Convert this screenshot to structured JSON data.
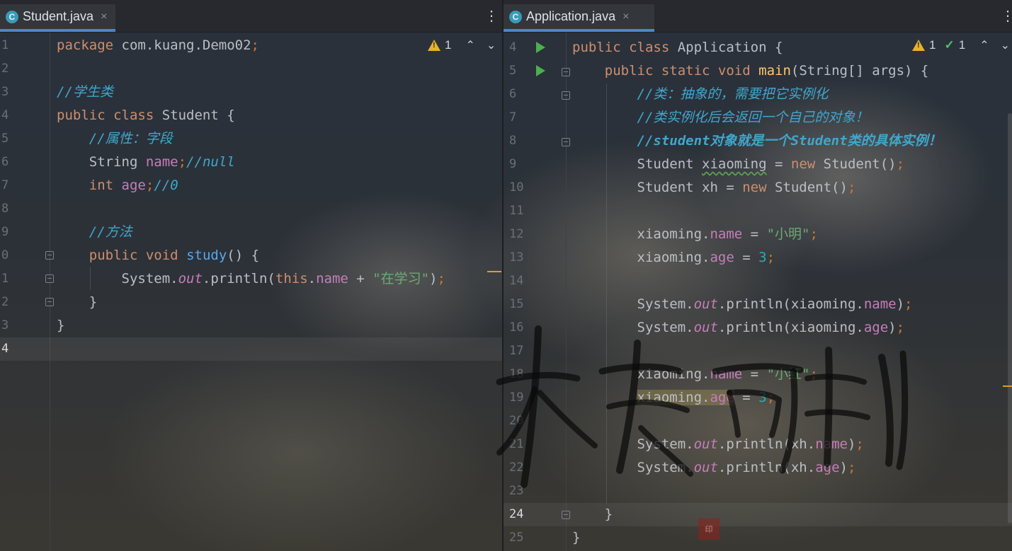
{
  "left_editor": {
    "tab": {
      "filename": "Student.java",
      "icon": "class-icon",
      "icon_letter": "C"
    },
    "inspections": {
      "warnings": "1"
    },
    "current_line": "4",
    "line_numbers": [
      "1",
      "2",
      "3",
      "4",
      "5",
      "6",
      "7",
      "8",
      "9",
      "0",
      "1",
      "2",
      "3",
      "4"
    ],
    "lines": [
      [
        [
          "kw",
          "package"
        ],
        [
          "pl",
          " com.kuang.Demo02"
        ],
        [
          "sem",
          ";"
        ]
      ],
      [],
      [
        [
          "cmt",
          "//学生类"
        ]
      ],
      [
        [
          "kw",
          "public class"
        ],
        [
          "pl",
          " Student {"
        ]
      ],
      [
        [
          "pl",
          "    "
        ],
        [
          "cmt",
          "//属性：字段"
        ]
      ],
      [
        [
          "pl",
          "    String "
        ],
        [
          "field",
          "name"
        ],
        [
          "sem",
          ";"
        ],
        [
          "cmt",
          "//null"
        ]
      ],
      [
        [
          "pl",
          "    "
        ],
        [
          "kw",
          "int"
        ],
        [
          "pl",
          " "
        ],
        [
          "field",
          "age"
        ],
        [
          "sem",
          ";"
        ],
        [
          "cmt",
          "//0"
        ]
      ],
      [],
      [
        [
          "pl",
          "    "
        ],
        [
          "cmt",
          "//方法"
        ]
      ],
      [
        [
          "pl",
          "    "
        ],
        [
          "kw",
          "public void"
        ],
        [
          "pl",
          " "
        ],
        [
          "fn",
          "study"
        ],
        [
          "pl",
          "() {"
        ]
      ],
      [
        [
          "pl",
          "        System."
        ],
        [
          "st",
          "out"
        ],
        [
          "pl",
          ".println("
        ],
        [
          "kw",
          "this"
        ],
        [
          "pl",
          "."
        ],
        [
          "field",
          "name"
        ],
        [
          "pl",
          " + "
        ],
        [
          "str",
          "\"在学习\""
        ],
        [
          "pl",
          ")"
        ],
        [
          "sem",
          ";"
        ]
      ],
      [
        [
          "pl",
          "    }"
        ]
      ],
      [
        [
          "pl",
          "}"
        ]
      ],
      []
    ]
  },
  "right_editor": {
    "tab": {
      "filename": "Application.java",
      "icon": "class-icon",
      "icon_letter": "C"
    },
    "inspections": {
      "warnings": "1",
      "typos": "1"
    },
    "current_line": "24",
    "line_numbers": [
      "4",
      "5",
      "6",
      "7",
      "8",
      "9",
      "10",
      "11",
      "12",
      "13",
      "14",
      "15",
      "16",
      "17",
      "18",
      "19",
      "20",
      "21",
      "22",
      "23",
      "24",
      "25"
    ],
    "lines": [
      [
        [
          "kw",
          "public class"
        ],
        [
          "pl",
          " Application {"
        ]
      ],
      [
        [
          "pl",
          "    "
        ],
        [
          "kw",
          "public static void"
        ],
        [
          "pl",
          " "
        ],
        [
          "main",
          "main"
        ],
        [
          "pl",
          "(String[] args) {"
        ]
      ],
      [
        [
          "pl",
          "        "
        ],
        [
          "cmt",
          "//类：抽象的，需要把它实例化"
        ]
      ],
      [
        [
          "pl",
          "        "
        ],
        [
          "cmt",
          "//类实例化后会返回一个自己的对象！"
        ]
      ],
      [
        [
          "pl",
          "        "
        ],
        [
          "cmt-b",
          "//student对象就是一个Student类的具体实例！"
        ]
      ],
      [
        [
          "pl",
          "        Student "
        ],
        [
          "sq",
          "xiaoming"
        ],
        [
          "pl",
          " = "
        ],
        [
          "kw",
          "new"
        ],
        [
          "pl",
          " Student()"
        ],
        [
          "sem",
          ";"
        ]
      ],
      [
        [
          "pl",
          "        Student xh = "
        ],
        [
          "kw",
          "new"
        ],
        [
          "pl",
          " Student()"
        ],
        [
          "sem",
          ";"
        ]
      ],
      [],
      [
        [
          "pl",
          "        xiaoming."
        ],
        [
          "field",
          "name"
        ],
        [
          "pl",
          " = "
        ],
        [
          "str",
          "\"小明\""
        ],
        [
          "sem",
          ";"
        ]
      ],
      [
        [
          "pl",
          "        xiaoming."
        ],
        [
          "field",
          "age"
        ],
        [
          "pl",
          " = "
        ],
        [
          "num",
          "3"
        ],
        [
          "sem",
          ";"
        ]
      ],
      [],
      [
        [
          "pl",
          "        System."
        ],
        [
          "st",
          "out"
        ],
        [
          "pl",
          ".println(xiaoming."
        ],
        [
          "field",
          "name"
        ],
        [
          "pl",
          ")"
        ],
        [
          "sem",
          ";"
        ]
      ],
      [
        [
          "pl",
          "        System."
        ],
        [
          "st",
          "out"
        ],
        [
          "pl",
          ".println(xiaoming."
        ],
        [
          "field",
          "age"
        ],
        [
          "pl",
          ")"
        ],
        [
          "sem",
          ";"
        ]
      ],
      [],
      [
        [
          "pl",
          "        xiaoming."
        ],
        [
          "field",
          "name"
        ],
        [
          "pl",
          " = "
        ],
        [
          "str",
          "\"小红\""
        ],
        [
          "sem",
          ";"
        ]
      ],
      [
        [
          "pl",
          "        "
        ],
        [
          "hl",
          "xiaoming."
        ],
        [
          "hlf",
          "age"
        ],
        [
          "pl",
          " = "
        ],
        [
          "num",
          "3"
        ],
        [
          "sem",
          ";"
        ]
      ],
      [],
      [
        [
          "pl",
          "        System."
        ],
        [
          "st",
          "out"
        ],
        [
          "pl",
          ".println(xh."
        ],
        [
          "field",
          "name"
        ],
        [
          "pl",
          ")"
        ],
        [
          "sem",
          ";"
        ]
      ],
      [
        [
          "pl",
          "        System."
        ],
        [
          "st",
          "out"
        ],
        [
          "pl",
          ".println(xh."
        ],
        [
          "field",
          "age"
        ],
        [
          "pl",
          ")"
        ],
        [
          "sem",
          ";"
        ]
      ],
      [],
      [
        [
          "pl",
          "    }"
        ]
      ],
      [
        [
          "pl",
          "}"
        ]
      ]
    ]
  },
  "icons": {
    "menu": "more-vertical-icon",
    "close": "close-icon",
    "warning": "warning-icon",
    "typo": "typo-check-icon",
    "prev": "chevron-up-icon",
    "next": "chevron-down-icon",
    "run": "run-gutter-icon",
    "fold": "fold-icon"
  },
  "glyphs": {
    "close": "×",
    "menu": "⋮",
    "up": "⌃",
    "down": "⌄"
  },
  "colors": {
    "keyword": "#cf8e6d",
    "comment": "#3fa7cc",
    "string": "#6aab73",
    "field": "#c77dbb",
    "number": "#2aacb8",
    "method_decl": "#ffc66d",
    "tab_underline": "#4a88c7",
    "run_green": "#4caf50",
    "warning_yellow": "#e8b12c"
  }
}
